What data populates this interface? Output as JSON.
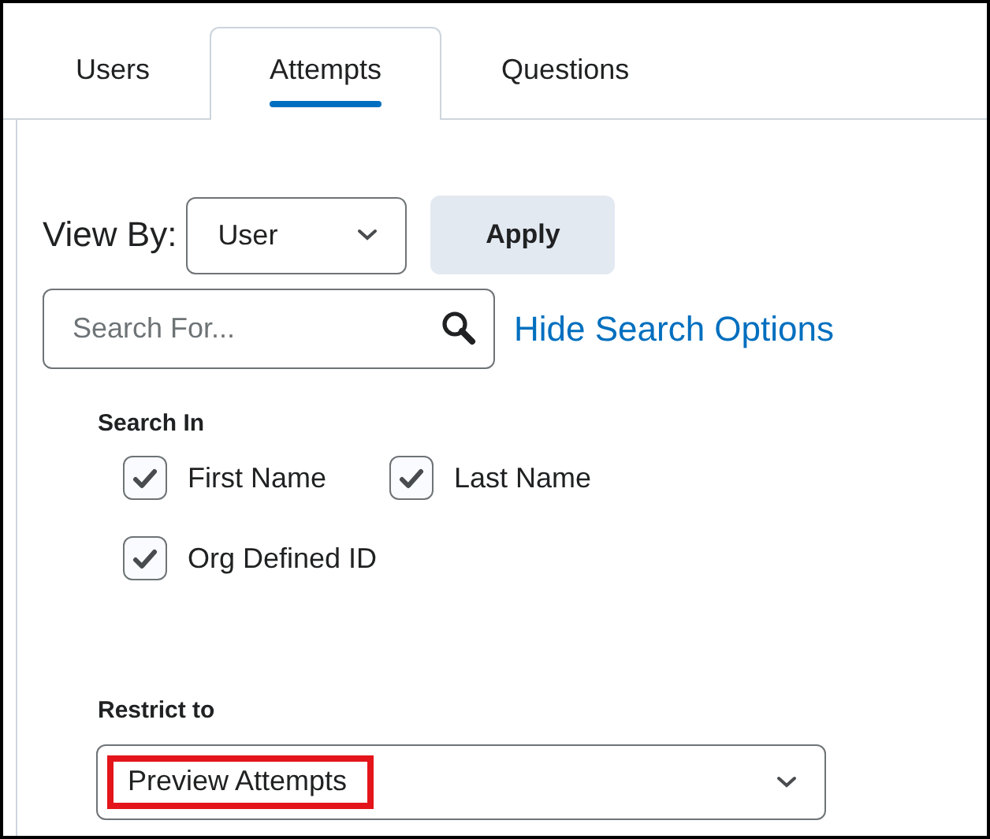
{
  "tabs": [
    {
      "label": "Users",
      "selected": false
    },
    {
      "label": "Attempts",
      "selected": true
    },
    {
      "label": "Questions",
      "selected": false
    }
  ],
  "view_by": {
    "label": "View By:",
    "value": "User"
  },
  "apply_button": "Apply",
  "search": {
    "placeholder": "Search For...",
    "options_link": "Hide Search Options"
  },
  "search_in": {
    "label": "Search In",
    "options": [
      {
        "label": "First Name",
        "checked": true
      },
      {
        "label": "Last Name",
        "checked": true
      },
      {
        "label": "Org Defined ID",
        "checked": true
      }
    ]
  },
  "restrict_to": {
    "label": "Restrict to",
    "value": "Preview Attempts",
    "highlighted": true
  }
}
